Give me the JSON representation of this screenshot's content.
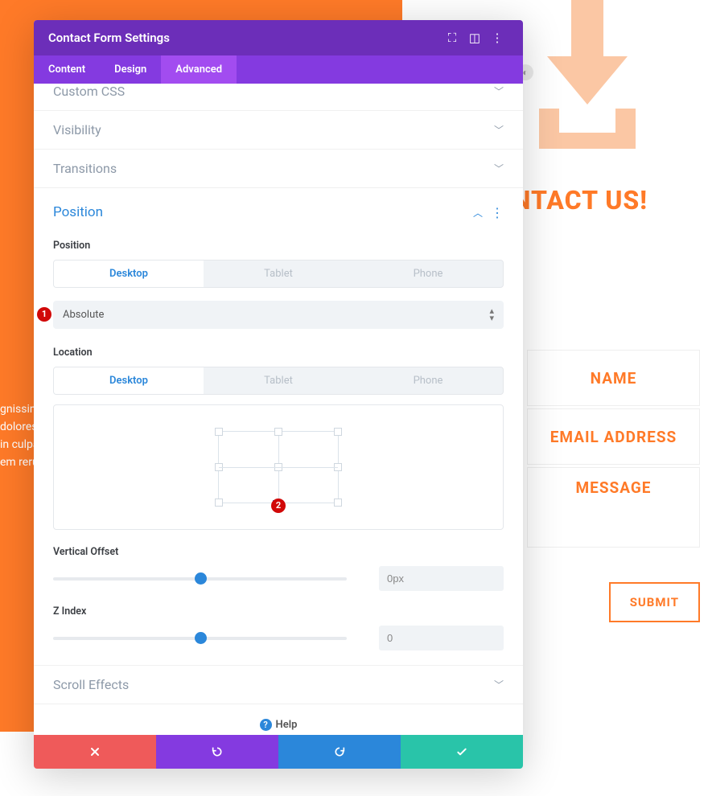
{
  "background": {
    "contact_us": "CONTACT US!",
    "text_lines": [
      "gnissim",
      "dolores",
      "in culpa",
      "em reru"
    ],
    "form": {
      "name": "NAME",
      "email": "EMAIL ADDRESS",
      "message": "MESSAGE",
      "submit": "SUBMIT"
    }
  },
  "modal": {
    "title": "Contact Form Settings",
    "tabs": {
      "content": "Content",
      "design": "Design",
      "advanced": "Advanced"
    },
    "sections": {
      "custom_css": "Custom CSS",
      "visibility": "Visibility",
      "transitions": "Transitions",
      "position": "Position",
      "scroll_effects": "Scroll Effects"
    },
    "position": {
      "label": "Position",
      "device_desktop": "Desktop",
      "device_tablet": "Tablet",
      "device_phone": "Phone",
      "select_value": "Absolute",
      "location_label": "Location",
      "vertical_offset_label": "Vertical Offset",
      "vertical_offset_value": "0px",
      "zindex_label": "Z Index",
      "zindex_value": "0"
    },
    "annotations": {
      "num1": "1",
      "num2": "2"
    },
    "help": "Help"
  }
}
